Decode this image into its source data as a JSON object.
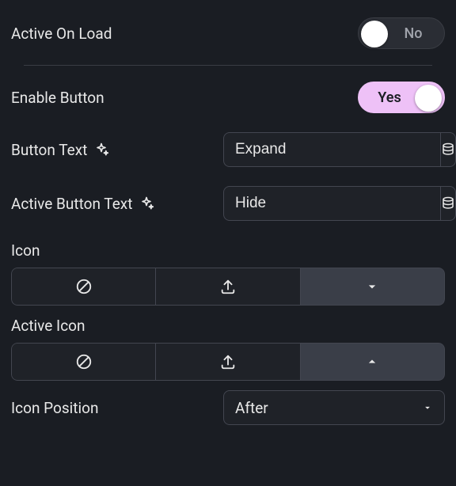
{
  "toggles": {
    "active_on_load": {
      "label": "Active On Load",
      "value": false,
      "text": "No"
    },
    "enable_button": {
      "label": "Enable Button",
      "value": true,
      "text": "Yes"
    }
  },
  "fields": {
    "button_text": {
      "label": "Button Text",
      "value": "Expand"
    },
    "active_button_text": {
      "label": "Active Button Text",
      "value": "Hide"
    }
  },
  "icon_section": {
    "label": "Icon",
    "selected_index": 2,
    "options": [
      "none",
      "upload",
      "chevron-down"
    ]
  },
  "active_icon_section": {
    "label": "Active Icon",
    "selected_index": 2,
    "options": [
      "none",
      "upload",
      "chevron-up"
    ]
  },
  "icon_position": {
    "label": "Icon Position",
    "value": "After"
  }
}
